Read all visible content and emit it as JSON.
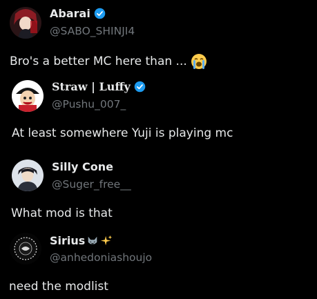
{
  "posts": [
    {
      "display_name": "Abarai",
      "handle": "@SABO_SHINJI4",
      "verified": true,
      "text": "Bro's a better MC here than ...",
      "text_emoji": "loudly-crying-face-emoji"
    },
    {
      "display_name": "Straw | Luffy",
      "handle": "@Pushu_007_",
      "verified": true,
      "text": "At least somewhere Yuji is playing mc"
    },
    {
      "display_name": "Silly Cone",
      "handle": "@Suger_free__",
      "verified": false,
      "text": "What mod is that"
    },
    {
      "display_name": "Sirius",
      "name_emojis": [
        "wolf-face-emoji",
        "sparkles-emoji"
      ],
      "handle": "@anhedoniashoujo",
      "verified": false,
      "text": "need the modlist"
    }
  ],
  "colors": {
    "background": "#000000",
    "primary_text": "#e7e9ea",
    "secondary_text": "#71767b",
    "verified_badge": "#1d9bf0"
  }
}
